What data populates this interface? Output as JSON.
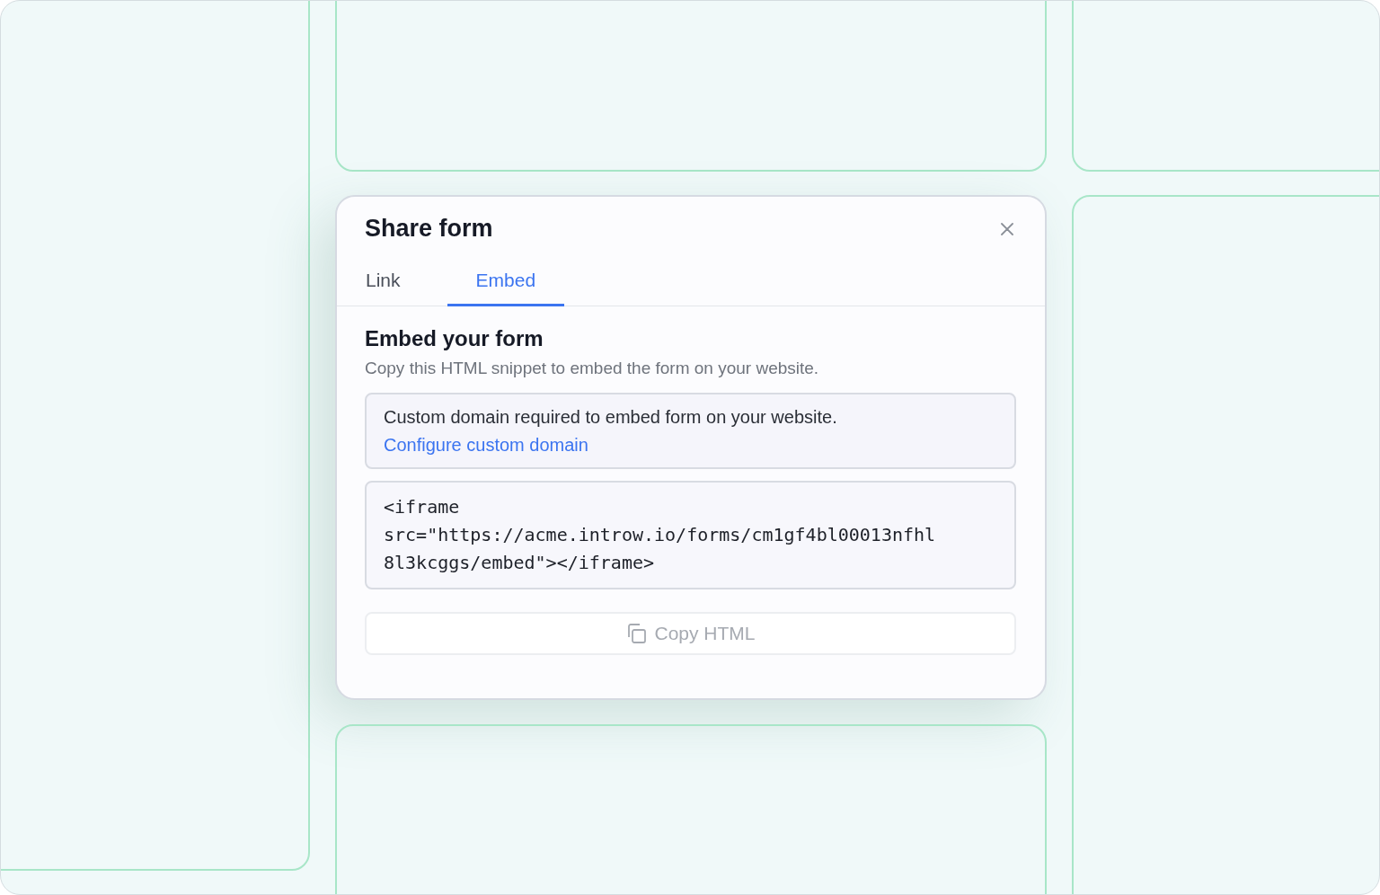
{
  "dialog": {
    "title": "Share form",
    "tabs": [
      {
        "label": "Link",
        "selected": false
      },
      {
        "label": "Embed",
        "selected": true
      }
    ],
    "section_title": "Embed your form",
    "description": "Copy this HTML snippet to embed the form on your website.",
    "notice": {
      "text": "Custom domain required to embed form on your website.",
      "link": "Configure custom domain"
    },
    "code_lines": [
      "<iframe",
      "src=\"https://acme.introw.io/forms/cm1gf4bl00013nfhl",
      "8l3kcggs/embed\"></iframe>"
    ],
    "copy_button": {
      "label": "Copy HTML",
      "disabled": true
    }
  }
}
